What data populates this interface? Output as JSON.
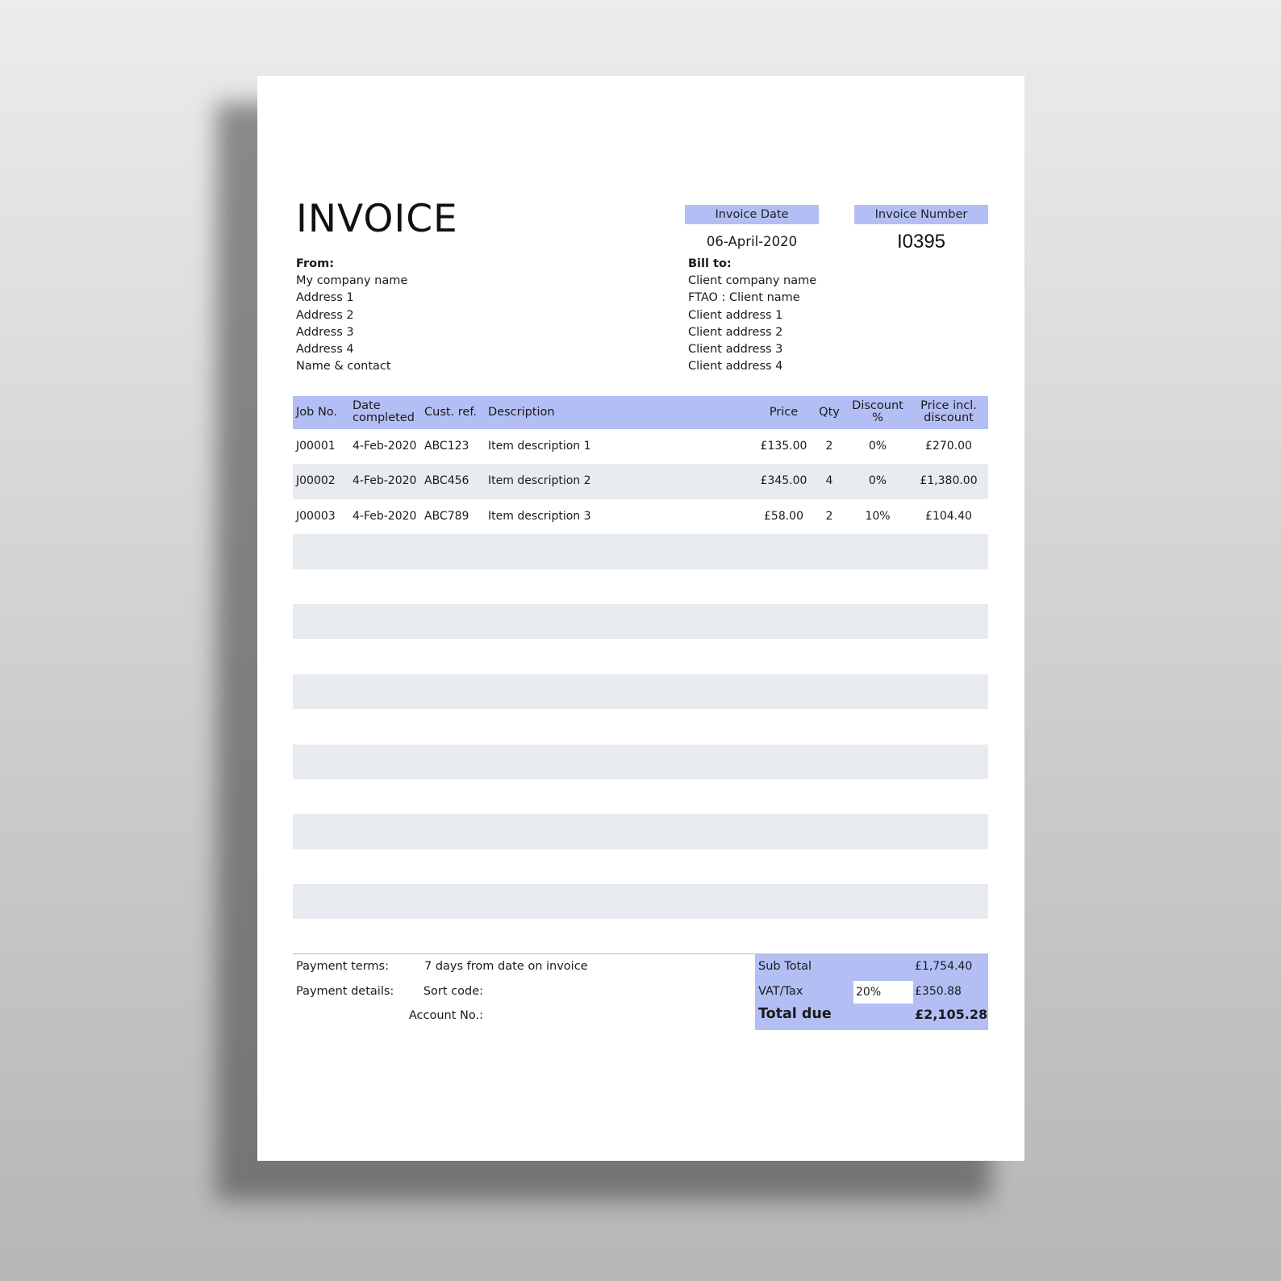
{
  "invoice": {
    "title": "INVOICE",
    "date_label": "Invoice Date",
    "date_value": "06-April-2020",
    "number_label": "Invoice Number",
    "number_value": "I0395"
  },
  "from": {
    "heading": "From:",
    "lines": [
      "My company name",
      "Address 1",
      "Address 2",
      "Address 3",
      "Address 4",
      "Name & contact"
    ]
  },
  "bill_to": {
    "heading": "Bill to:",
    "lines": [
      "Client company name",
      "FTAO : Client name",
      "Client address 1",
      "Client address 2",
      "Client address 3",
      "Client address 4"
    ]
  },
  "table": {
    "headers": {
      "job": "Job No.",
      "date_1": "Date",
      "date_2": "completed",
      "ref": "Cust. ref.",
      "desc": "Description",
      "price": "Price",
      "qty": "Qty",
      "disc_1": "Discount",
      "disc_2": "%",
      "total_1": "Price incl.",
      "total_2": "discount"
    },
    "rows": [
      {
        "job": "J00001",
        "date": "4-Feb-2020",
        "ref": "ABC123",
        "desc": "Item description 1",
        "price": "£135.00",
        "qty": "2",
        "disc": "0%",
        "total": "£270.00"
      },
      {
        "job": "J00002",
        "date": "4-Feb-2020",
        "ref": "ABC456",
        "desc": "Item description 2",
        "price": "£345.00",
        "qty": "4",
        "disc": "0%",
        "total": "£1,380.00"
      },
      {
        "job": "J00003",
        "date": "4-Feb-2020",
        "ref": "ABC789",
        "desc": "Item description 3",
        "price": "£58.00",
        "qty": "2",
        "disc": "10%",
        "total": "£104.40"
      }
    ],
    "empty_rows": 12,
    "colors": {
      "header_bg": "#b3bff4",
      "stripe_bg": "#e8ebef"
    }
  },
  "footer": {
    "terms_label": "Payment terms:",
    "terms_value": "7 days from date on invoice",
    "details_label": "Payment details:",
    "sort_code_label": "Sort code:",
    "account_label": "Account No.:"
  },
  "totals": {
    "subtotal_label": "Sub Total",
    "subtotal_value": "£1,754.40",
    "vat_label": "VAT/Tax",
    "vat_rate": "20%",
    "vat_value": "£350.88",
    "total_label": "Total due",
    "total_value": "£2,105.28"
  }
}
